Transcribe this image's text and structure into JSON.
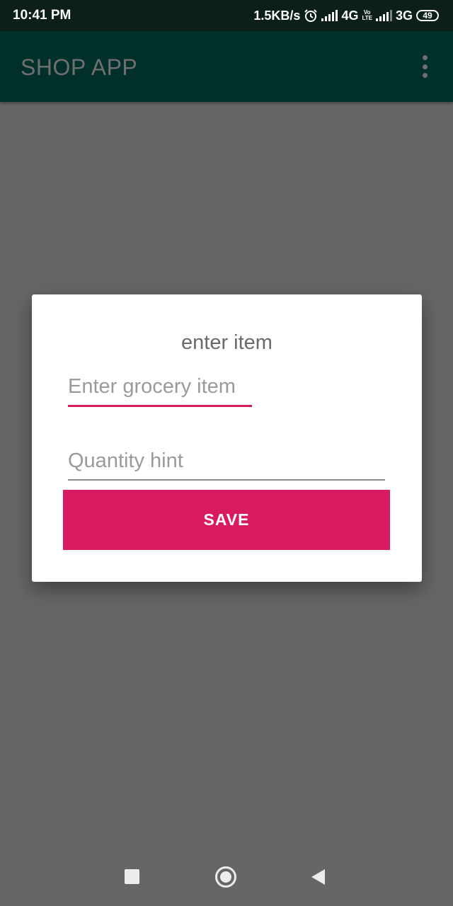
{
  "status_bar": {
    "time": "10:41 PM",
    "network_speed": "1.5KB/s",
    "network_type_1": "4G",
    "volte_label_top": "Vo",
    "volte_label_bottom": "LTE",
    "network_type_2": "3G",
    "battery_level": "49",
    "icons": [
      "alarm-icon",
      "signal-icon",
      "signal-icon",
      "battery-icon"
    ]
  },
  "app_bar": {
    "title": "SHOP APP",
    "menu_icon": "more-vert-icon"
  },
  "dialog": {
    "title": "enter item",
    "item_input": {
      "placeholder": "Enter grocery item",
      "value": ""
    },
    "quantity_input": {
      "placeholder": "Quantity hint",
      "value": ""
    },
    "save_label": "SAVE"
  },
  "nav_bar": {
    "icons": [
      "recent-apps-icon",
      "home-icon",
      "back-icon"
    ]
  },
  "colors": {
    "accent": "#d81b60",
    "app_bar": "#01302b",
    "status_bar": "#0c1f1b",
    "scrim_background": "#666666"
  }
}
